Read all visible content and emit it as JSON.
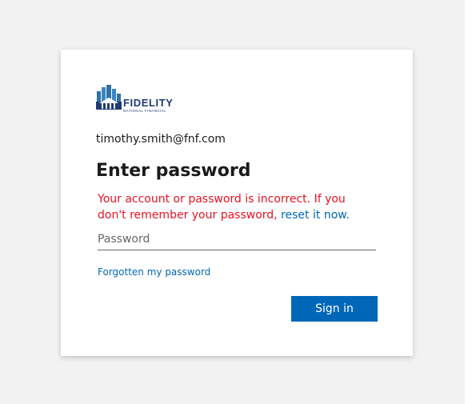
{
  "logo": {
    "name": "FIDELITY",
    "subtitle": "NATIONAL FINANCIAL",
    "icon": "fidelity-building-logo"
  },
  "account": {
    "email": "timothy.smith@fnf.com"
  },
  "heading": "Enter password",
  "error": {
    "message": "Your account or password is incorrect. If you don't remember your password,",
    "link_text": "reset it now."
  },
  "password_field": {
    "placeholder": "Password",
    "value": ""
  },
  "forgot_link": "Forgotten my password",
  "signin_button": "Sign in",
  "colors": {
    "accent": "#0067b8",
    "error": "#e81123",
    "page_background": "#f2f2f2",
    "brand": "#1f3b73"
  }
}
